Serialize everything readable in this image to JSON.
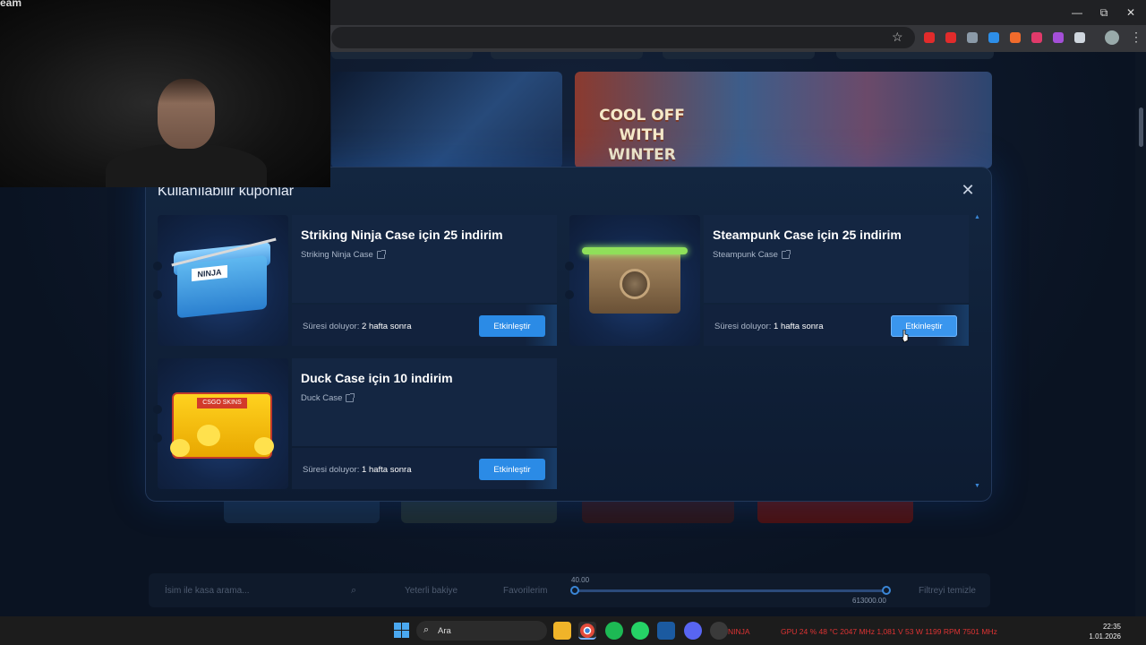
{
  "webcam": {
    "overlay_text": "eam"
  },
  "browser": {
    "window_controls": {
      "minimize": "—",
      "restore": "⧉",
      "close": "✕"
    },
    "bookmark_icon": "star-icon",
    "extension_colors": [
      "#e22b2b",
      "#e22b2b",
      "#8b9aa8",
      "#2d8ee8",
      "#f06b2c",
      "#e03a6a",
      "#a44fd8",
      "#cfd6de"
    ],
    "extension_badge": "1",
    "menu_icon": "kebab-icon"
  },
  "page_bg": {
    "banner_title": "COOL OFF WITH WINTER",
    "filter": {
      "search_placeholder": "İsim ile kasa arama...",
      "affordable_label": "Yeterli bakiye",
      "favorites_label": "Favorilerim",
      "range_min": "40.00",
      "range_max": "613000.00",
      "clear_label": "Filtreyi temizle"
    }
  },
  "modal": {
    "title": "Kullanılabilir kuponlar",
    "close_icon": "close-icon",
    "coupons": [
      {
        "title": "Striking Ninja Case için 25 indirim",
        "case_name": "Striking Ninja Case",
        "expiry_label": "Süresi doluyor:",
        "expiry_value": "2 hafta sonra",
        "button": "Etkinleştir"
      },
      {
        "title": "Steampunk Case için 25 indirim",
        "case_name": "Steampunk Case",
        "expiry_label": "Süresi doluyor:",
        "expiry_value": "1 hafta sonra",
        "button": "Etkinleştir"
      },
      {
        "title": "Duck Case için 10 indirim",
        "case_name": "Duck Case",
        "expiry_label": "Süresi doluyor:",
        "expiry_value": "1 hafta sonra",
        "button": "Etkinleştir"
      }
    ],
    "ninja_art_label": "NINJA",
    "duck_art_label": "CSGO SKINS"
  },
  "taskbar": {
    "search_label": "Ara",
    "nzxt_label": "NINJA",
    "stats": "GPU  24 %  48 °C  2047 MHz  1,081 V  53 W  1199 RPM  7501 MHz",
    "time": "22:35",
    "date": "1.01.2026"
  },
  "colors": {
    "accent": "#2b8be6",
    "modal_bg": "#132640",
    "page_bg": "#0b1424"
  }
}
